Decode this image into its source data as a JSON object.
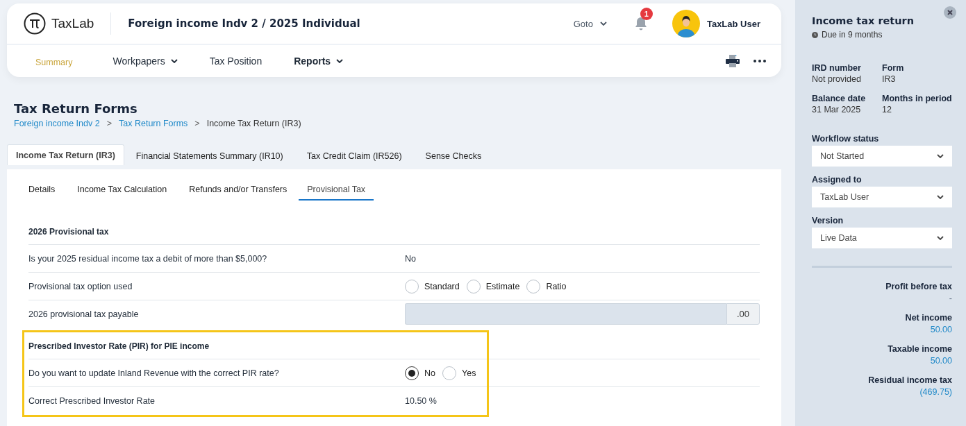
{
  "header": {
    "logo": "TaxLab",
    "title": "Foreign income Indv 2 / 2025 Individual",
    "goto": "Goto",
    "notification_count": "1",
    "user": "TaxLab User"
  },
  "nav": [
    {
      "label": "Summary",
      "selected": true,
      "emphasized": false,
      "dropdown": false
    },
    {
      "label": "Workpapers",
      "selected": false,
      "emphasized": false,
      "dropdown": true
    },
    {
      "label": "Tax Position",
      "selected": false,
      "emphasized": false,
      "dropdown": false
    },
    {
      "label": "Reports",
      "selected": false,
      "emphasized": true,
      "dropdown": true
    }
  ],
  "page_title": "Tax Return Forms",
  "breadcrumb": [
    {
      "label": "Foreign income Indv 2",
      "kind": "link"
    },
    {
      "label": "Tax Return Forms",
      "kind": "link",
      "separator": ">"
    },
    {
      "label": "Income Tax Return (IR3)",
      "kind": "current",
      "separator": ">"
    }
  ],
  "form_tabs": [
    {
      "label": "Income Tax Return (IR3)",
      "selected": true
    },
    {
      "label": "Financial Statements Summary (IR10)",
      "selected": false
    },
    {
      "label": "Tax Credit Claim (IR526)",
      "selected": false
    },
    {
      "label": "Sense Checks",
      "selected": false
    }
  ],
  "sub_tabs": [
    {
      "label": "Details",
      "selected": false
    },
    {
      "label": "Income Tax Calculation",
      "selected": false
    },
    {
      "label": "Refunds and/or Transfers",
      "selected": false
    },
    {
      "label": "Provisional Tax",
      "selected": true
    }
  ],
  "sections": [
    {
      "title": "2026 Provisional tax",
      "highlighted": false,
      "rows": [
        {
          "kind": "text",
          "label": "Is your 2025 residual income tax a debit of more than $5,000?",
          "value": "No"
        },
        {
          "kind": "radio",
          "label": "Provisional tax option used",
          "options": [
            {
              "label": "Standard",
              "selected": false
            },
            {
              "label": "Estimate",
              "selected": false
            },
            {
              "label": "Ratio",
              "selected": false
            }
          ]
        },
        {
          "kind": "amount",
          "label": "2026 provisional tax payable",
          "suffix": ".00"
        }
      ]
    },
    {
      "title": "Prescribed Investor Rate (PIR) for PIE income",
      "highlighted": true,
      "rows": [
        {
          "kind": "radio",
          "label": "Do you want to update Inland Revenue with the correct PIR rate?",
          "options": [
            {
              "label": "No",
              "selected": true
            },
            {
              "label": "Yes",
              "selected": false
            }
          ]
        },
        {
          "kind": "text",
          "label": "Correct Prescribed Investor Rate",
          "value": "10.50 %"
        }
      ]
    }
  ],
  "side_panel": {
    "title": "Income tax return",
    "due": "Due in 9 months",
    "facts": [
      {
        "label": "IRD number",
        "value": "Not provided"
      },
      {
        "label": "Form",
        "value": "IR3"
      },
      {
        "label": "Balance date",
        "value": "31 Mar 2025"
      },
      {
        "label": "Months in period",
        "value": "12"
      }
    ],
    "selects": [
      {
        "label": "Workflow status",
        "value": "Not Started"
      },
      {
        "label": "Assigned to",
        "value": "TaxLab User"
      },
      {
        "label": "Version",
        "value": "Live Data"
      }
    ],
    "totals": [
      {
        "label": "Profit before tax",
        "value": "-"
      },
      {
        "label": "Net income",
        "value": "50.00"
      },
      {
        "label": "Taxable income",
        "value": "50.00"
      },
      {
        "label": "Residual income tax",
        "value": "(469.75)"
      }
    ]
  }
}
